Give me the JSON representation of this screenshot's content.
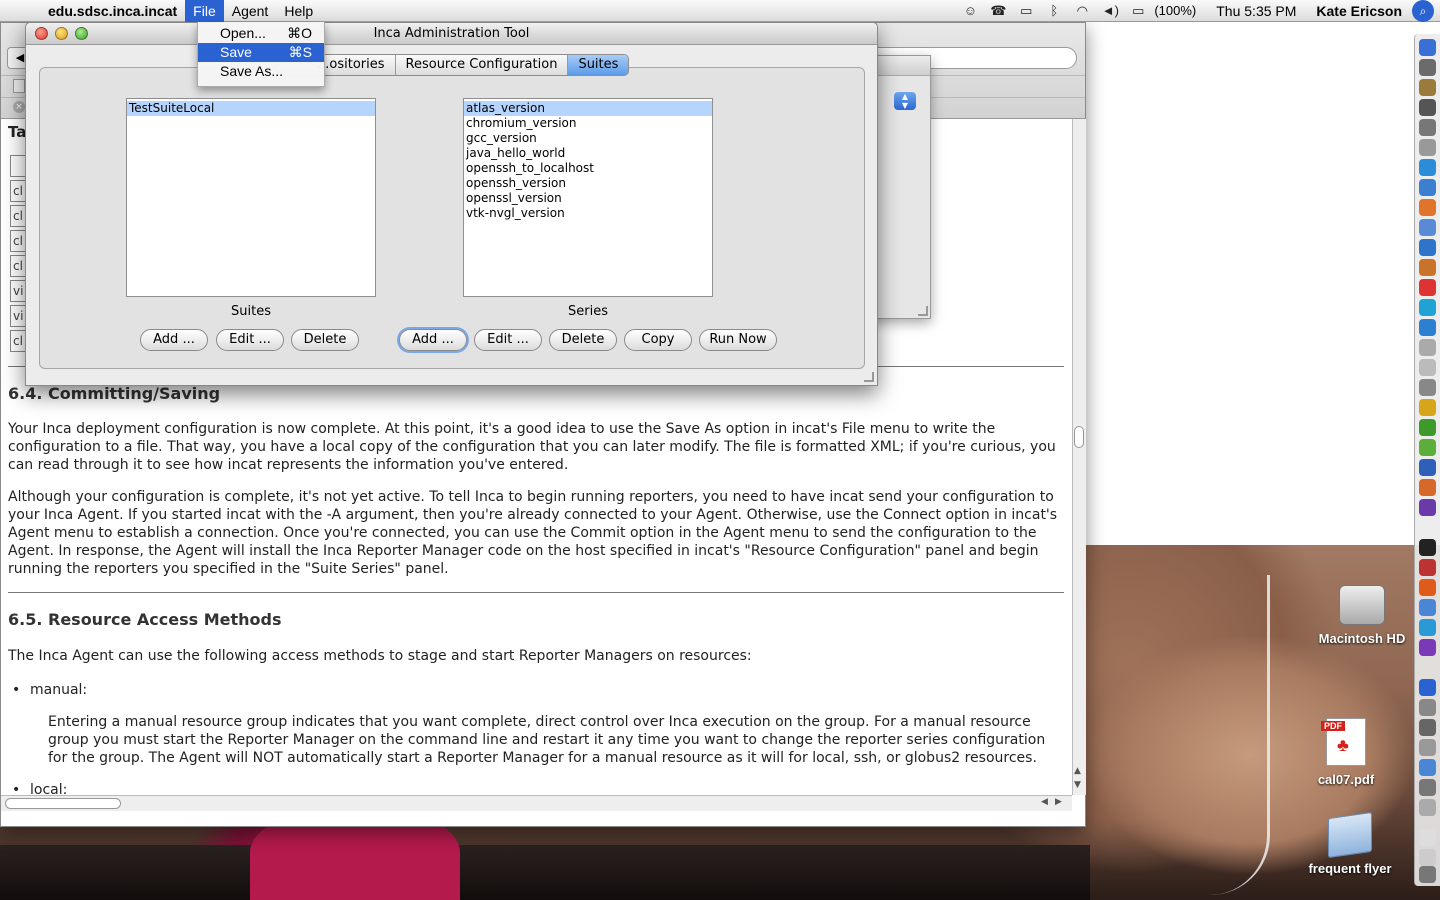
{
  "menubar": {
    "app_name": "edu.sdsc.inca.incat",
    "menus": [
      "File",
      "Agent",
      "Help"
    ],
    "battery": "(100%)",
    "clock": "Thu 5:35 PM",
    "user": "Kate Ericson",
    "status_icons": [
      "user-icon",
      "phone-icon",
      "keyboard-icon",
      "bluetooth-icon",
      "wifi-icon",
      "volume-icon",
      "battery-icon"
    ]
  },
  "file_menu": {
    "items": [
      {
        "label": "Open...",
        "shortcut": "⌘O"
      },
      {
        "label": "Save",
        "shortcut": "⌘S"
      },
      {
        "label": "Save As...",
        "shortcut": ""
      }
    ],
    "selected_index": 1
  },
  "inca_window": {
    "title": "Inca Administration Tool",
    "tabs": [
      "...ositories",
      "Resource Configuration",
      "Suites"
    ],
    "active_tab": "Suites",
    "suites": {
      "caption": "Suites",
      "items": [
        "TestSuiteLocal"
      ],
      "selected_index": 0,
      "buttons": [
        "Add ...",
        "Edit ...",
        "Delete"
      ]
    },
    "series": {
      "caption": "Series",
      "items": [
        "atlas_version",
        "chromium_version",
        "gcc_version",
        "java_hello_world",
        "openssh_to_localhost",
        "openssh_version",
        "openssl_version",
        "vtk-nvgl_version"
      ],
      "selected_index": 0,
      "buttons": [
        "Add ...",
        "Edit ...",
        "Delete",
        "Copy",
        "Run Now"
      ]
    }
  },
  "document": {
    "fragment_heading": "Ta",
    "fragment_boxes": [
      "",
      "cl",
      "cl",
      "cl",
      "cl",
      "vi",
      "vi",
      "cl"
    ],
    "sections": [
      {
        "heading": "6.4. Committing/Saving",
        "paragraphs": [
          "Your Inca deployment configuration is now complete. At this point, it's a good idea to use the Save As option in incat's File menu to write the configuration to a file. That way, you have a local copy of the configuration that you can later modify. The file is formatted XML; if you're curious, you can read through it to see how incat represents the information you've entered.",
          "Although your configuration is complete, it's not yet active. To tell Inca to begin running reporters, you need to have incat send your configuration to your Inca Agent. If you started incat with the -A argument, then you're already connected to your Agent. Otherwise, use the Connect option in incat's Agent menu to establish a connection. Once you're connected, you can use the Commit option in the Agent menu to send the configuration to the Agent. In response, the Agent will install the Inca Reporter Manager code on the host specified in incat's \"Resource Configuration\" panel and begin running the reporters you specified in the \"Suite Series\" panel."
        ]
      },
      {
        "heading": "6.5. Resource Access Methods",
        "paragraphs": [
          "The Inca Agent can use the following access methods to stage and start Reporter Managers on resources:"
        ],
        "list": [
          {
            "term": "manual:",
            "text": "Entering a manual resource group indicates that you want complete, direct control over Inca execution on the group. For a manual resource group you must start the Reporter Manager on the command line and restart it any time you want to change the reporter series configuration for the group. The Agent will NOT automatically start a Reporter Manager for a manual resource as it will for local, ssh, or globus2 resources."
          },
          {
            "term": "local:",
            "text": ""
          }
        ]
      }
    ]
  },
  "desktop_icons": [
    {
      "name": "harddrive-icon",
      "label": "Macintosh HD"
    },
    {
      "name": "pdf-file-icon",
      "label": "cal07.pdf",
      "tag": "PDF",
      "logo_text": "Adobe"
    },
    {
      "name": "folder-icon",
      "label": "frequent flyer"
    }
  ],
  "colors": {
    "selection": "#2a62d2",
    "list_selection": "#b5d5ff",
    "active_tab": "#5d9be8"
  }
}
